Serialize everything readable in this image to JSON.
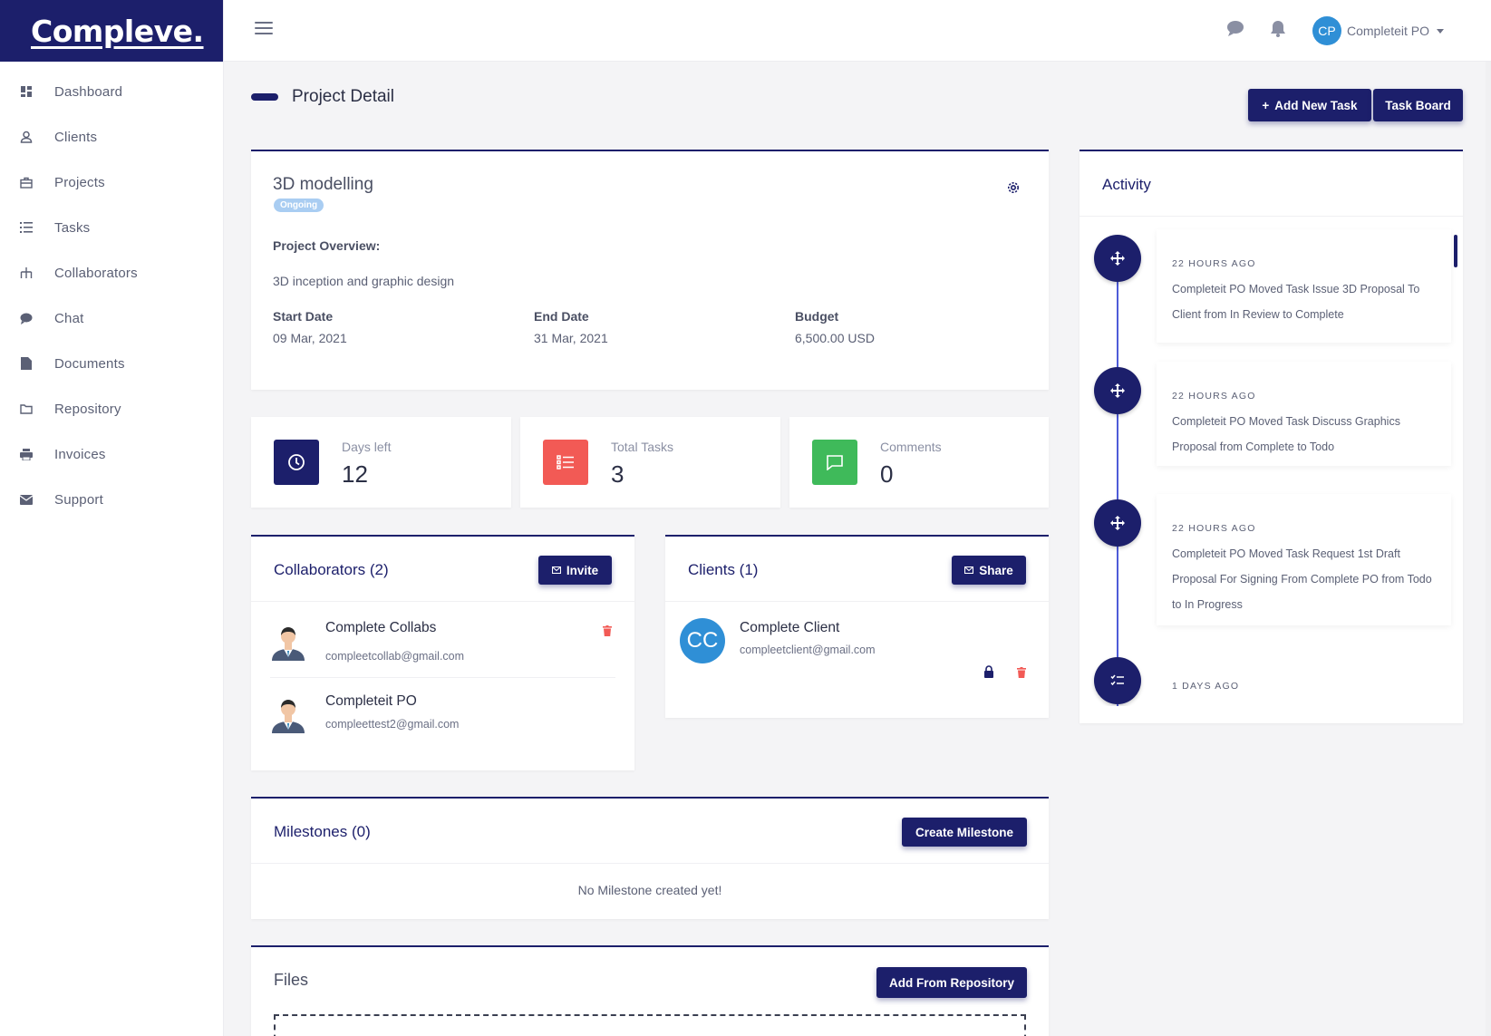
{
  "brand": {
    "logo_text": "Compleve."
  },
  "sidebar": {
    "items": [
      {
        "label": "Dashboard",
        "icon": "dashboard-icon"
      },
      {
        "label": "Clients",
        "icon": "user-icon"
      },
      {
        "label": "Projects",
        "icon": "briefcase-icon"
      },
      {
        "label": "Tasks",
        "icon": "list-icon"
      },
      {
        "label": "Collaborators",
        "icon": "sitemap-icon"
      },
      {
        "label": "Chat",
        "icon": "chat-icon"
      },
      {
        "label": "Documents",
        "icon": "document-icon"
      },
      {
        "label": "Repository",
        "icon": "folder-icon"
      },
      {
        "label": "Invoices",
        "icon": "printer-icon"
      },
      {
        "label": "Support",
        "icon": "envelope-icon"
      }
    ]
  },
  "topbar": {
    "user": {
      "initials": "CP",
      "name": "Completeit PO"
    }
  },
  "page": {
    "title": "Project Detail",
    "add_task_label": "Add New Task",
    "task_board_label": "Task Board"
  },
  "project": {
    "name": "3D modelling",
    "status": "Ongoing",
    "overview_label": "Project Overview:",
    "overview": "3D inception and graphic design",
    "start_label": "Start Date",
    "start": "09 Mar, 2021",
    "end_label": "End Date",
    "end": "31 Mar, 2021",
    "budget_label": "Budget",
    "budget": "6,500.00 USD"
  },
  "stats": {
    "days": {
      "label": "Days left",
      "value": "12",
      "color": "#1c1f6b"
    },
    "tasks": {
      "label": "Total Tasks",
      "value": "3",
      "color": "#f25a55"
    },
    "comments": {
      "label": "Comments",
      "value": "0",
      "color": "#3fba5a"
    }
  },
  "collaborators": {
    "title": "Collaborators (2)",
    "invite_label": "Invite",
    "people": [
      {
        "name": "Complete Collabs",
        "email": "compleetcollab@gmail.com"
      },
      {
        "name": "Completeit PO",
        "email": "compleettest2@gmail.com"
      }
    ]
  },
  "clients": {
    "title": "Clients (1)",
    "share_label": "Share",
    "people": [
      {
        "initials": "CC",
        "name": "Complete Client",
        "email": "compleetclient@gmail.com"
      }
    ]
  },
  "milestones": {
    "title": "Milestones (0)",
    "create_label": "Create Milestone",
    "empty": "No Milestone created yet!"
  },
  "files": {
    "title": "Files",
    "add_label": "Add From Repository"
  },
  "activity": {
    "title": "Activity",
    "items": [
      {
        "time": "22 HOURS AGO",
        "text": "Completeit PO Moved Task Issue 3D Proposal To Client from In Review to Complete"
      },
      {
        "time": "22 HOURS AGO",
        "text": "Completeit PO Moved Task Discuss Graphics Proposal from Complete to Todo"
      },
      {
        "time": "22 HOURS AGO",
        "text": "Completeit PO Moved Task Request 1st Draft Proposal For Signing From Complete PO from Todo to In Progress"
      },
      {
        "time": "1 DAYS AGO",
        "text": ""
      }
    ]
  },
  "colors": {
    "primary": "#1c1f6b",
    "danger": "#f25a55",
    "success": "#3fba5a",
    "status_badge": "#a9cdf2",
    "avatar": "#2f8fd6"
  }
}
